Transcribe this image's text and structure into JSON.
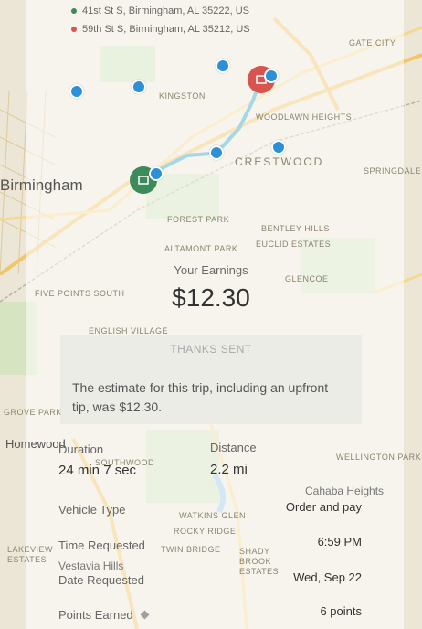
{
  "trip": {
    "pickup_address": "41st St S, Birmingham, AL 35222, US",
    "dropoff_address": "59th St S, Birmingham, AL 35212, US"
  },
  "map": {
    "labels": {
      "birmingham": "Birmingham",
      "crestwood": "CRESTWOOD",
      "homewood": "Homewood",
      "kingston": "KINGSTON",
      "woodlawn_heights": "WOODLAWN HEIGHTS",
      "forest_park": "FOREST PARK",
      "altamont_park": "ALTAMONT PARK",
      "five_points_south": "FIVE POINTS SOUTH",
      "english_village": "ENGLISH VILLAGE",
      "bentley_hills": "BENTLEY HILLS",
      "euclid_estates": "EUCLID ESTATES",
      "glencoe": "GLENCOE",
      "cahaba_heights": "Cahaba Heights",
      "vestavia_hills": "Vestavia Hills",
      "gate_city": "GATE CITY",
      "springdale": "SPRINGDALE",
      "wellington_park": "WELLINGTON PARK",
      "southwood": "SOUTHWOOD",
      "rocky_ridge": "ROCKY RIDGE",
      "watkins_glen": "WATKINS GLEN",
      "twin_bridge": "TWIN BRIDGE",
      "shady_brook_estates": "SHADY BROOK ESTATES",
      "lakeview_estates": "LAKEVIEW ESTATES",
      "grove_park": "GROVE PARK"
    },
    "colors": {
      "route": "#3aa6c4",
      "pickup": "#3d8a5a",
      "dropoff": "#d9534f",
      "waypoint": "#2d8fd6"
    }
  },
  "earnings": {
    "label": "Your Earnings",
    "amount": "$12.30"
  },
  "tip": {
    "title": "THANKS SENT",
    "message": "The estimate for this trip, including an upfront tip, was $12.30."
  },
  "details": {
    "duration_label": "Duration",
    "duration_value": "24 min 7 sec",
    "distance_label": "Distance",
    "distance_value": "2.2 mi",
    "vehicle_type_label": "Vehicle Type",
    "vehicle_type_value": "Order and pay",
    "time_requested_label": "Time Requested",
    "time_requested_value": "6:59 PM",
    "date_requested_label": "Date Requested",
    "date_requested_value": "Wed, Sep 22",
    "points_label": "Points Earned",
    "points_value": "6 points"
  }
}
